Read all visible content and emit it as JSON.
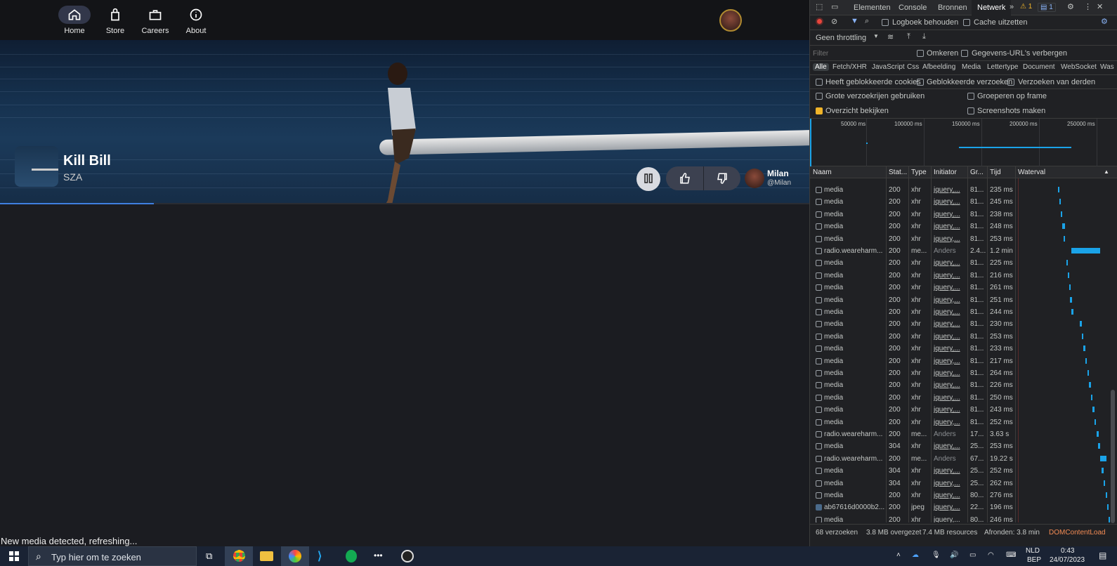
{
  "nav": {
    "items": [
      {
        "label": "Home",
        "icon": "home-icon",
        "active": true
      },
      {
        "label": "Store",
        "icon": "shopping-bag-icon"
      },
      {
        "label": "Careers",
        "icon": "briefcase-icon"
      },
      {
        "label": "About",
        "icon": "info-icon"
      }
    ]
  },
  "player": {
    "title": "Kill Bill",
    "artist": "SZA",
    "progress": 0.19,
    "dj_name": "Milan",
    "dj_handle": "@Milan"
  },
  "status_message": "New media detected, refreshing...",
  "devtools": {
    "tabs": [
      "Elementen",
      "Console",
      "Bronnen",
      "Netwerk"
    ],
    "selected_tab": "Netwerk",
    "warnings": "1",
    "messages": "1",
    "toolbar": {
      "preserve_log": "Logboek behouden",
      "disable_cache": "Cache uitzetten"
    },
    "throttling": "Geen throttling",
    "filter_placeholder": "Filter",
    "invert": "Omkeren",
    "hide_data_urls": "Gegevens-URL's verbergen",
    "type_filters": [
      "Alle",
      "Fetch/XHR",
      "JavaScript",
      "Css",
      "Afbeelding",
      "Media",
      "Lettertype",
      "Document",
      "WebSocket",
      "Was"
    ],
    "options1": [
      "Heeft geblokkeerde cookies",
      "Geblokkeerde verzoeken",
      "Verzoeken van derden"
    ],
    "options2": [
      "Grote verzoekrijen gebruiken",
      "Groeperen op frame",
      "Overzicht bekijken",
      "Screenshots maken"
    ],
    "overview_ticks": [
      "50000 ms",
      "100000 ms",
      "150000 ms",
      "200000 ms",
      "250000 ms"
    ],
    "columns": [
      "Naam",
      "Stat...",
      "Type",
      "Initiator",
      "Gr...",
      "Tijd",
      "Waterval"
    ],
    "rows": [
      {
        "name": "media",
        "status": "200",
        "type": "xhr",
        "initiator": "jquery,...",
        "size": "81...",
        "time": "235 ms",
        "w": 0.43,
        "wl": 0.02
      },
      {
        "name": "media",
        "status": "200",
        "type": "xhr",
        "initiator": "jquery,...",
        "size": "81...",
        "time": "245 ms",
        "w": 0.445,
        "wl": 0.02
      },
      {
        "name": "media",
        "status": "200",
        "type": "xhr",
        "initiator": "jquery,...",
        "size": "81...",
        "time": "238 ms",
        "w": 0.46,
        "wl": 0.02
      },
      {
        "name": "media",
        "status": "200",
        "type": "xhr",
        "initiator": "jquery,...",
        "size": "81...",
        "time": "248 ms",
        "w": 0.475,
        "wl": 0.03
      },
      {
        "name": "media",
        "status": "200",
        "type": "xhr",
        "initiator": "jquery,...",
        "size": "81...",
        "time": "253 ms",
        "w": 0.49,
        "wl": 0.02
      },
      {
        "name": "radio.weareharm...",
        "status": "200",
        "type": "me...",
        "initiator": "Anders",
        "size": "2.4...",
        "time": "1.2 min",
        "w": 0.5,
        "wl": 0.31
      },
      {
        "name": "media",
        "status": "200",
        "type": "xhr",
        "initiator": "jquery,...",
        "size": "81...",
        "time": "225 ms",
        "w": 0.52,
        "wl": 0.02
      },
      {
        "name": "media",
        "status": "200",
        "type": "xhr",
        "initiator": "jquery,...",
        "size": "81...",
        "time": "216 ms",
        "w": 0.535,
        "wl": 0.02
      },
      {
        "name": "media",
        "status": "200",
        "type": "xhr",
        "initiator": "jquery,...",
        "size": "81...",
        "time": "261 ms",
        "w": 0.55,
        "wl": 0.02
      },
      {
        "name": "media",
        "status": "200",
        "type": "xhr",
        "initiator": "jquery,...",
        "size": "81...",
        "time": "251 ms",
        "w": 0.565,
        "wl": 0.02
      },
      {
        "name": "media",
        "status": "200",
        "type": "xhr",
        "initiator": "jquery,...",
        "size": "81...",
        "time": "244 ms",
        "w": 0.58,
        "wl": 0.02
      },
      {
        "name": "media",
        "status": "200",
        "type": "xhr",
        "initiator": "jquery,...",
        "size": "81...",
        "time": "230 ms",
        "w": 0.67,
        "wl": 0.02
      },
      {
        "name": "media",
        "status": "200",
        "type": "xhr",
        "initiator": "jquery,...",
        "size": "81...",
        "time": "253 ms",
        "w": 0.69,
        "wl": 0.02
      },
      {
        "name": "media",
        "status": "200",
        "type": "xhr",
        "initiator": "jquery,...",
        "size": "81...",
        "time": "233 ms",
        "w": 0.71,
        "wl": 0.02
      },
      {
        "name": "media",
        "status": "200",
        "type": "xhr",
        "initiator": "jquery,...",
        "size": "81...",
        "time": "217 ms",
        "w": 0.73,
        "wl": 0.02
      },
      {
        "name": "media",
        "status": "200",
        "type": "xhr",
        "initiator": "jquery,...",
        "size": "81...",
        "time": "264 ms",
        "w": 0.75,
        "wl": 0.02
      },
      {
        "name": "media",
        "status": "200",
        "type": "xhr",
        "initiator": "jquery,...",
        "size": "81...",
        "time": "226 ms",
        "w": 0.77,
        "wl": 0.02
      },
      {
        "name": "media",
        "status": "200",
        "type": "xhr",
        "initiator": "jquery,...",
        "size": "81...",
        "time": "250 ms",
        "w": 0.79,
        "wl": 0.02
      },
      {
        "name": "media",
        "status": "200",
        "type": "xhr",
        "initiator": "jquery,...",
        "size": "81...",
        "time": "243 ms",
        "w": 0.81,
        "wl": 0.02
      },
      {
        "name": "media",
        "status": "200",
        "type": "xhr",
        "initiator": "jquery,...",
        "size": "81...",
        "time": "252 ms",
        "w": 0.83,
        "wl": 0.02
      },
      {
        "name": "radio.weareharm...",
        "status": "200",
        "type": "me...",
        "initiator": "Anders",
        "size": "17...",
        "time": "3.63 s",
        "w": 0.85,
        "wl": 0.03
      },
      {
        "name": "media",
        "status": "304",
        "type": "xhr",
        "initiator": "jquery,...",
        "size": "25...",
        "time": "253 ms",
        "w": 0.87,
        "wl": 0.02
      },
      {
        "name": "radio.weareharm...",
        "status": "200",
        "type": "me...",
        "initiator": "Anders",
        "size": "67...",
        "time": "19.22 s",
        "w": 0.89,
        "wl": 0.07
      },
      {
        "name": "media",
        "status": "304",
        "type": "xhr",
        "initiator": "jquery,...",
        "size": "25...",
        "time": "252 ms",
        "w": 0.91,
        "wl": 0.02
      },
      {
        "name": "media",
        "status": "304",
        "type": "xhr",
        "initiator": "jquery,...",
        "size": "25...",
        "time": "262 ms",
        "w": 0.93,
        "wl": 0.02
      },
      {
        "name": "media",
        "status": "200",
        "type": "xhr",
        "initiator": "jquery,...",
        "size": "80...",
        "time": "276 ms",
        "w": 0.95,
        "wl": 0.02
      },
      {
        "name": "ab67616d0000b2...",
        "status": "200",
        "type": "jpeg",
        "initiator": "jquery,...",
        "size": "22...",
        "time": "196 ms",
        "w": 0.97,
        "wl": 0.01
      },
      {
        "name": "media",
        "status": "200",
        "type": "xhr",
        "initiator": "jquery,...",
        "size": "80...",
        "time": "246 ms",
        "w": 0.985,
        "wl": 0.01
      }
    ],
    "footer": [
      "68 verzoeken",
      "3.8 MB overgezet",
      "7.4 MB resources",
      "Afronden: 3.8 min",
      "DOMContentLoad"
    ]
  },
  "taskbar": {
    "search_placeholder": "Typ hier om te zoeken",
    "lang_top": "NLD",
    "lang_bottom": "BEP",
    "time": "0:43",
    "date": "24/07/2023"
  },
  "colors": {
    "accent": "#3f7fe0",
    "waterfall": "#1aa3e8",
    "devtools_bg": "#202124",
    "checkbox_on": "#f0b429"
  }
}
